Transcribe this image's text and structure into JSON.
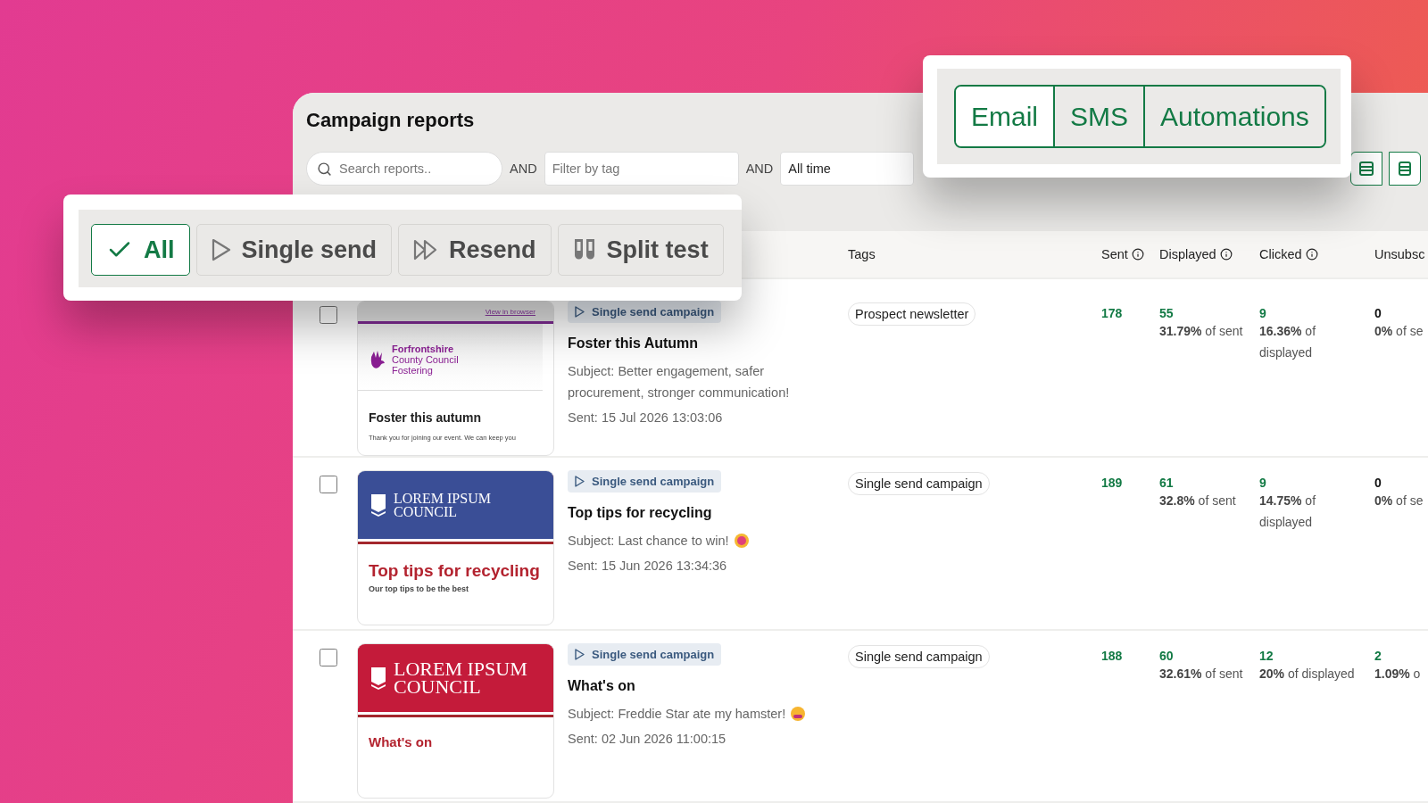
{
  "title": "Campaign reports",
  "filters": {
    "search": {
      "placeholder": "Search reports.."
    },
    "joiners": [
      "AND",
      "AND"
    ],
    "tag": {
      "placeholder": "Filter by tag"
    },
    "date": {
      "value": "All time"
    }
  },
  "type_filter": [
    {
      "label": "All",
      "selected": true
    },
    {
      "label": "Single send",
      "selected": false
    },
    {
      "label": "Resend",
      "selected": false
    },
    {
      "label": "Split test",
      "selected": false
    }
  ],
  "channel_tabs": [
    {
      "label": "Email",
      "selected": true
    },
    {
      "label": "SMS",
      "selected": false
    },
    {
      "label": "Automations",
      "selected": false
    }
  ],
  "columns": [
    {
      "label": "Tags",
      "info": false
    },
    {
      "label": "Sent",
      "info": true
    },
    {
      "label": "Displayed",
      "info": true
    },
    {
      "label": "Clicked",
      "info": true
    },
    {
      "label": "Unsubsc",
      "info": false
    }
  ],
  "rows": [
    {
      "selected": false,
      "preview": {
        "kind": "logo",
        "link": "View in browser",
        "logo": [
          "Forfrontshire",
          "County Council",
          "Fostering"
        ],
        "heading": "Foster this autumn",
        "body": "Thank you for joining our event. We can keep you"
      },
      "badge": "Single send campaign",
      "name": "Foster this Autumn",
      "subject": "Subject: Better engagement, safer procurement, stronger communication!",
      "sent_at": "Sent: 15 Jul 2026 13:03:06",
      "tag": "Prospect newsletter",
      "sent": "178",
      "displayed": {
        "count": "55",
        "rate": "**31.79%** of sent"
      },
      "clicked": {
        "count": "9",
        "rate": "**16.36%** of displayed"
      },
      "unsubscribed": {
        "count": "0",
        "rate": "**0%** of se",
        "highlighted": false
      }
    },
    {
      "selected": false,
      "preview": {
        "kind": "banner",
        "color": "#3a4e96",
        "logo": [
          "LOREM IPSUM",
          "COUNCIL"
        ],
        "heading": "Top tips for recycling",
        "body": "Our top tips to be the best"
      },
      "badge": "Single send campaign",
      "name": "Top tips for recycling",
      "subject": "Subject: Last chance to win!",
      "emoji": true,
      "sent_at": "Sent: 15 Jun 2026 13:34:36",
      "tag": "Single send campaign",
      "sent": "189",
      "displayed": {
        "count": "61",
        "rate": "**32.8%** of sent"
      },
      "clicked": {
        "count": "9",
        "rate": "**14.75%** of displayed"
      },
      "unsubscribed": {
        "count": "0",
        "rate": "**0%** of se",
        "highlighted": false
      }
    },
    {
      "selected": false,
      "preview": {
        "kind": "banner",
        "color": "#c41b3a",
        "logo": [
          "LOREM IPSUM",
          "COUNCIL"
        ],
        "heading": "What's on"
      },
      "badge": "Single send campaign",
      "name": "What's on",
      "subject": "Subject: Freddie Star ate my hamster!",
      "emoji": true,
      "sent_at": "Sent: 02 Jun 2026 11:00:15",
      "tag": "Single send campaign",
      "sent": "188",
      "displayed": {
        "count": "60",
        "rate": "**32.61%** of sent"
      },
      "clicked": {
        "count": "12",
        "rate": "**20%** of displayed"
      },
      "unsubscribed": {
        "count": "2",
        "rate": "**1.09%** o",
        "highlighted": true
      }
    }
  ]
}
